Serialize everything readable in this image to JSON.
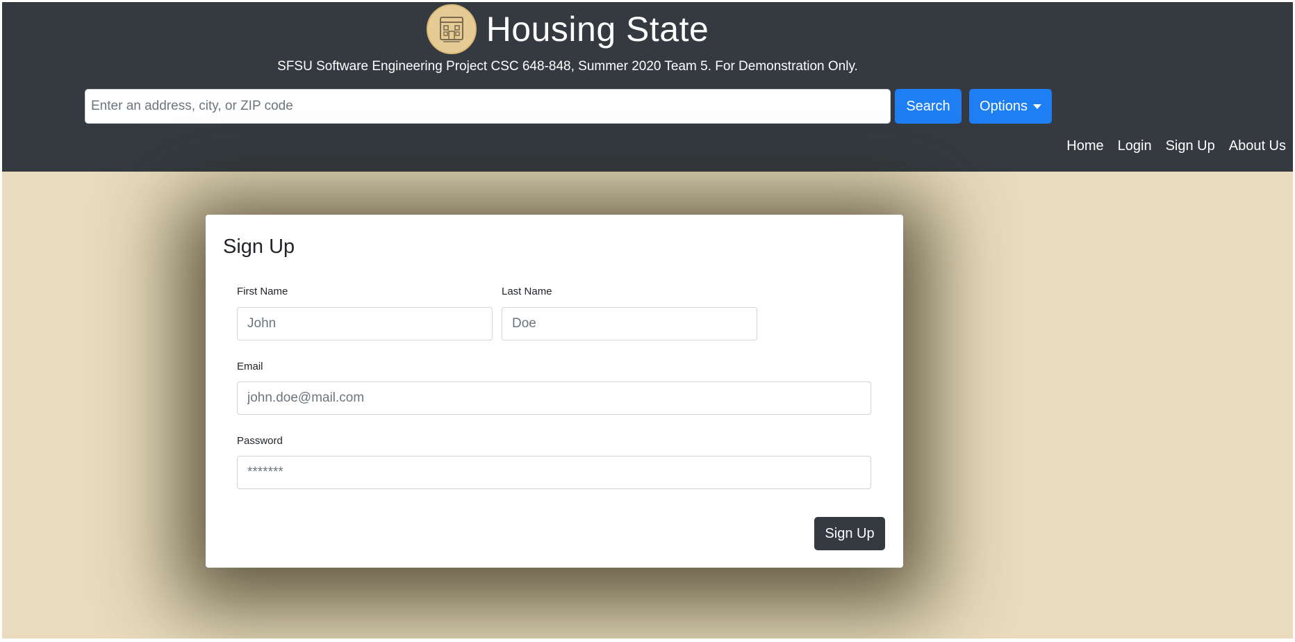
{
  "site": {
    "title": "Housing State",
    "tagline": "SFSU Software Engineering Project CSC 648-848, Summer 2020 Team 5. For Demonstration Only."
  },
  "search": {
    "placeholder": "Enter an address, city, or ZIP code",
    "search_label": "Search",
    "options_label": "Options"
  },
  "nav": {
    "home": "Home",
    "login": "Login",
    "signup": "Sign Up",
    "about": "About Us"
  },
  "form": {
    "title": "Sign Up",
    "first_name_label": "First Name",
    "first_name_placeholder": "John",
    "last_name_label": "Last Name",
    "last_name_placeholder": "Doe",
    "email_label": "Email",
    "email_placeholder": "john.doe@mail.com",
    "password_label": "Password",
    "password_placeholder": "*******",
    "submit_label": "Sign Up"
  },
  "icons": {
    "logo": "house-logo-icon",
    "options_caret": "caret-down-icon"
  },
  "colors": {
    "header_bg": "#343a40",
    "page_bg": "#e8dcbc",
    "primary": "#1e7ff5",
    "submit_bg": "#343a40",
    "logo_bg": "#e6cc94"
  }
}
